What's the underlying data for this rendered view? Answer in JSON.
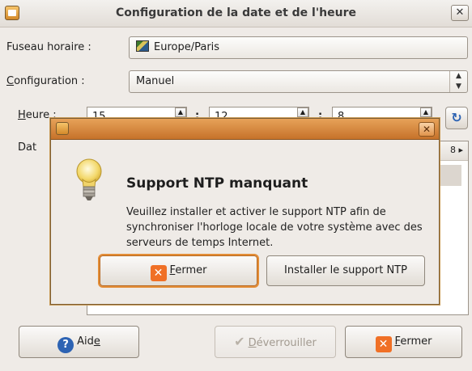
{
  "window": {
    "title": "Configuration de la date et de l'heure",
    "close_glyph": "✕"
  },
  "form": {
    "timezone_label": "Fuseau horaire :",
    "timezone_value": "Europe/Paris",
    "configuration_label_underlined": "C",
    "configuration_label_rest": "onfiguration :",
    "configuration_value": "Manuel",
    "time_label_underlined": "H",
    "time_label_rest": "eure :",
    "hour": "15",
    "minute": "12",
    "second": "8",
    "time_separator": ":",
    "date_label_visible": "Dat",
    "calendar_visible_fragment": "8 ▸"
  },
  "buttons": {
    "help_label_prefix": "Aid",
    "help_label_underlined": "e",
    "unlock_label_underlined": "D",
    "unlock_label_rest": "éverrouiller",
    "close_label_underlined": "F",
    "close_label_rest": "ermer"
  },
  "dialog": {
    "close_glyph": "✕",
    "heading": "Support NTP manquant",
    "message": "Veuillez installer et activer le support NTP afin de synchroniser l'horloge locale de votre système avec des serveurs de temps Internet.",
    "close_button_underlined": "F",
    "close_button_rest": "ermer",
    "install_button": "Installer le support NTP"
  },
  "icons": {
    "timezone": "timezone-flag-icon",
    "refresh": "refresh-icon",
    "help": "help-icon",
    "unlock": "check-icon",
    "close": "close-x-icon",
    "bulb": "lightbulb-icon"
  },
  "colors": {
    "dialog_titlebar": "#d98a3f",
    "close_icon": "#f07026",
    "help_icon": "#2d63b3",
    "focus_ring": "#e38d37"
  }
}
